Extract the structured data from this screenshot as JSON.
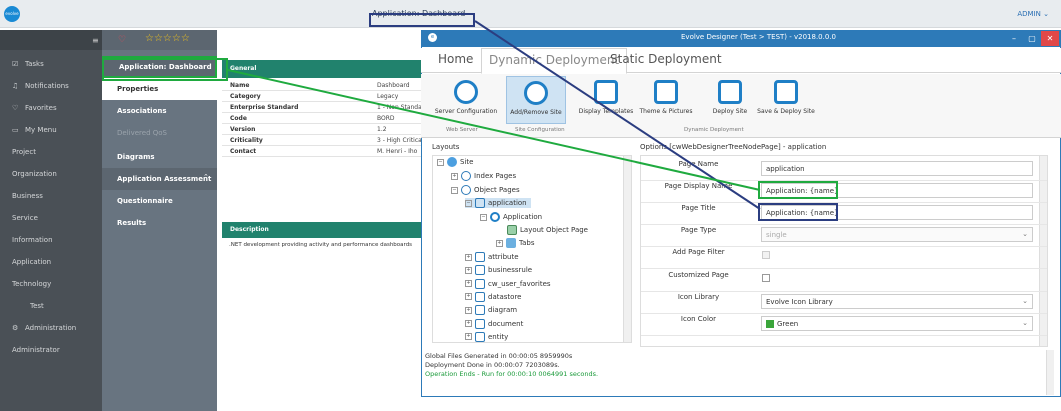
{
  "top": {
    "app_title": "Application: Dashboard",
    "user": "ADMIN"
  },
  "sidebar": {
    "items": [
      {
        "label": "Tasks",
        "icon": "check-square-icon"
      },
      {
        "label": "Notifications",
        "icon": "bell-icon"
      },
      {
        "label": "Favorites",
        "icon": "heart-icon"
      },
      {
        "label": "My Menu",
        "icon": "bookmark-icon"
      },
      {
        "label": "Project"
      },
      {
        "label": "Organization"
      },
      {
        "label": "Business"
      },
      {
        "label": "Service"
      },
      {
        "label": "Information"
      },
      {
        "label": "Application"
      },
      {
        "label": "Technology"
      },
      {
        "label": "Test"
      },
      {
        "label": "Administration",
        "icon": "gears-icon"
      },
      {
        "label": "Administrator"
      }
    ]
  },
  "panel": {
    "stars": "☆☆☆☆☆",
    "items": [
      "Application: Dashboard",
      "Properties",
      "Associations",
      "Delivered QoS",
      "Diagrams",
      "Application Assessment",
      "Questionnaire",
      "Results"
    ]
  },
  "general": {
    "title": "General",
    "rows": [
      {
        "k": "Name",
        "v": "Dashboard"
      },
      {
        "k": "Category",
        "v": "Legacy"
      },
      {
        "k": "Enterprise Standard",
        "v": "1 - Non Standard"
      },
      {
        "k": "Code",
        "v": "BORD"
      },
      {
        "k": "Version",
        "v": "1.2"
      },
      {
        "k": "Criticality",
        "v": "3 - High Criticality"
      },
      {
        "k": "Contact",
        "v": "M. Henri - Iho"
      }
    ]
  },
  "description": {
    "title": "Description",
    "text": ".NET development providing activity and performance dashboards"
  },
  "window": {
    "title": "Evolve Designer (Test > TEST) - v2018.0.0.0",
    "tabs": [
      "Home",
      "Dynamic Deployment",
      "Static Deployment"
    ],
    "ribbon": [
      {
        "label": "Server Configuration"
      },
      {
        "label": "Add/Remove Site"
      },
      {
        "label": "Display Templates"
      },
      {
        "label": "Theme & Pictures"
      },
      {
        "label": "Deploy Site"
      },
      {
        "label": "Save & Deploy Site"
      }
    ],
    "groups": [
      "Web Server",
      "Site Configuration",
      "Dynamic Deployment"
    ],
    "layouts_title": "Layouts",
    "tree": {
      "site": "Site",
      "index_pages": "Index Pages",
      "object_pages": "Object Pages",
      "application": "application",
      "application_node": "Application",
      "layout_object_page": "Layout Object Page",
      "tabs": "Tabs",
      "items": [
        "attribute",
        "businessrule",
        "cw_user_favorites",
        "datastore",
        "diagram",
        "document",
        "entity"
      ]
    },
    "options_title": "Options [cwWebDesignerTreeNodePage] - application",
    "options": [
      {
        "label": "Page Name",
        "value": "application"
      },
      {
        "label": "Page Display Name",
        "value": "Application: {name}"
      },
      {
        "label": "Page Title",
        "value": "Application: {name}"
      },
      {
        "label": "Page Type",
        "value": "single"
      },
      {
        "label": "Add Page Filter",
        "value": ""
      },
      {
        "label": "Customized Page",
        "value": ""
      },
      {
        "label": "Icon Library",
        "value": "Evolve Icon Library"
      },
      {
        "label": "Icon Color",
        "value": "Green"
      }
    ],
    "log": [
      "Global Files Generated in 00:00:05 8959990s",
      "Deployment Done in 00:00:07 7203089s.",
      "Operation Ends - Run for 00:00:10 0064991 seconds."
    ]
  },
  "colors": {
    "highlight_green": "#1faa3f",
    "highlight_blue": "#2b3d80",
    "teal": "#21826d",
    "window_blue": "#2d7ab8"
  }
}
